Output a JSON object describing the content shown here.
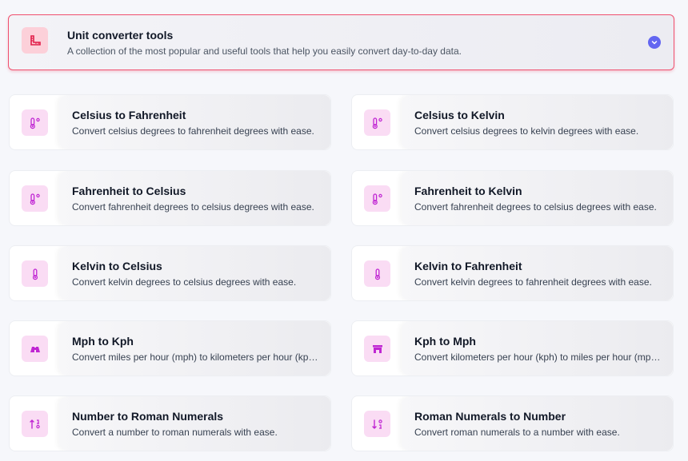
{
  "header": {
    "title": "Unit converter tools",
    "description": "A collection of the most popular and useful tools that help you easily convert day-to-day data.",
    "icon": "ruler-icon",
    "toggle_icon": "chevron-down-icon"
  },
  "colors": {
    "accent_border": "#f0506e",
    "icon_bg": "#fadcf4",
    "icon_fg": "#c026d3",
    "header_icon_bg": "#fcd0d9",
    "header_icon_fg": "#e11d48",
    "chevron_bg": "#6366f1"
  },
  "tools": [
    {
      "title": "Celsius to Fahrenheit",
      "description": "Convert celsius degrees to fahrenheit degrees with ease.",
      "icon": "temperature-celsius-icon"
    },
    {
      "title": "Celsius to Kelvin",
      "description": "Convert celsius degrees to kelvin degrees with ease.",
      "icon": "temperature-celsius-icon"
    },
    {
      "title": "Fahrenheit to Celsius",
      "description": "Convert fahrenheit degrees to celsius degrees with ease.",
      "icon": "temperature-celsius-icon"
    },
    {
      "title": "Fahrenheit to Kelvin",
      "description": "Convert fahrenheit degrees to celsius degrees with ease.",
      "icon": "temperature-celsius-icon"
    },
    {
      "title": "Kelvin to Celsius",
      "description": "Convert kelvin degrees to celsius degrees with ease.",
      "icon": "thermometer-icon"
    },
    {
      "title": "Kelvin to Fahrenheit",
      "description": "Convert kelvin degrees to fahrenheit degrees with ease.",
      "icon": "thermometer-icon"
    },
    {
      "title": "Mph to Kph",
      "description": "Convert miles per hour (mph) to kilometers per hour (kph) with ease.",
      "icon": "binoculars-icon"
    },
    {
      "title": "Kph to Mph",
      "description": "Convert kilometers per hour (kph) to miles per hour (mph) with ease.",
      "icon": "road-icon"
    },
    {
      "title": "Number to Roman Numerals",
      "description": "Convert a number to roman numerals with ease.",
      "icon": "sort-numeric-icon"
    },
    {
      "title": "Roman Numerals to Number",
      "description": "Convert roman numerals to a number with ease.",
      "icon": "sort-numeric-down-icon"
    }
  ]
}
